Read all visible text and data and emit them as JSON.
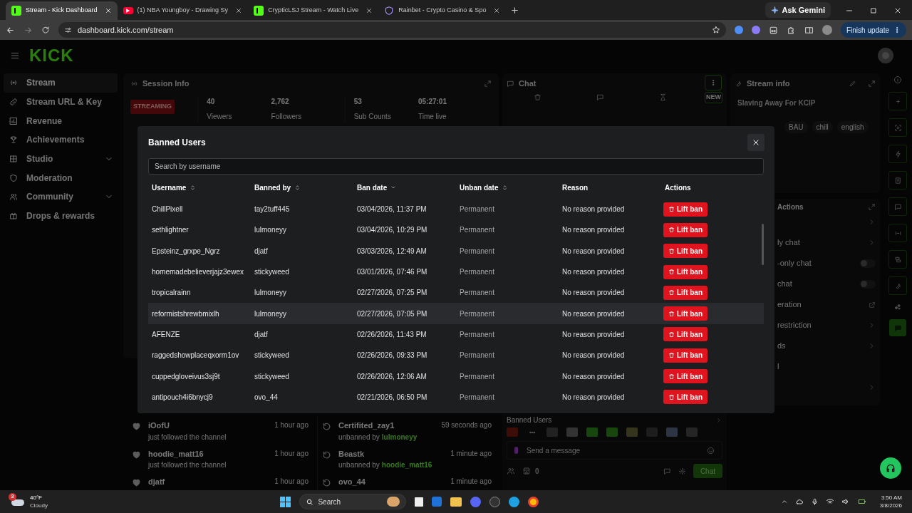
{
  "browser": {
    "tabs": [
      {
        "title": "Stream - Kick Dashboard",
        "kind": "kick",
        "selected": true
      },
      {
        "title": "(1) NBA Youngboy - Drawing Sy",
        "kind": "video",
        "selected": false
      },
      {
        "title": "CrypticLSJ Stream - Watch Live",
        "kind": "kick",
        "selected": false
      },
      {
        "title": "Rainbet - Crypto Casino & Spo",
        "kind": "casino",
        "selected": false
      }
    ],
    "ask_button": "Ask Gemini",
    "url": "dashboard.kick.com/stream",
    "update_button": "Finish update"
  },
  "header": {
    "logo": "KICK"
  },
  "sidebar": {
    "items": [
      {
        "label": "Stream",
        "chevron": false,
        "selected": true
      },
      {
        "label": "Stream URL & Key",
        "chevron": false,
        "selected": false
      },
      {
        "label": "Revenue",
        "chevron": false,
        "selected": false
      },
      {
        "label": "Achievements",
        "chevron": false,
        "selected": false
      },
      {
        "label": "Studio",
        "chevron": true,
        "selected": false
      },
      {
        "label": "Moderation",
        "chevron": false,
        "selected": false
      },
      {
        "label": "Community",
        "chevron": true,
        "selected": false
      },
      {
        "label": "Drops & rewards",
        "chevron": false,
        "selected": false
      }
    ]
  },
  "session_info": {
    "title": "Session Info",
    "status": "STREAMING",
    "stats": [
      {
        "value": "40",
        "label": "Viewers"
      },
      {
        "value": "2,762",
        "label": "Followers"
      },
      {
        "value": "53",
        "label": "Sub Counts"
      },
      {
        "value": "05:27:01",
        "label": "Time live"
      }
    ]
  },
  "chat_panel": {
    "title": "Chat",
    "new_badge": "NEW"
  },
  "stream_info": {
    "title": "Stream info",
    "stream_title": "Slaving Away For KCIP",
    "tags": [
      "BAU",
      "chill",
      "english"
    ]
  },
  "actions_panel": {
    "title": "Actions",
    "items": [
      {
        "kind": "chevron"
      },
      {
        "label": "ly chat",
        "kind": "chevron"
      },
      {
        "label": "-only chat",
        "kind": "toggle",
        "on": false
      },
      {
        "label": "chat",
        "kind": "toggle",
        "on": false
      },
      {
        "label": "eration",
        "kind": "external"
      },
      {
        "label": "restriction",
        "kind": "chevron"
      },
      {
        "label": "ds",
        "kind": "chevron"
      },
      {
        "label": "l",
        "kind": "plain"
      },
      {
        "kind": "chevron"
      }
    ]
  },
  "follower_feed": [
    {
      "name": "iOofU",
      "action": "just followed the channel",
      "time": "1 hour ago"
    },
    {
      "name": "hoodie_matt16",
      "action": "just followed the channel",
      "time": "1 hour ago"
    },
    {
      "name": "djatf",
      "time": "1 hour ago"
    }
  ],
  "unban_feed": [
    {
      "name": "Certifited_zay1",
      "action": "unbanned by",
      "by": "lulmoneyy",
      "time": "59 seconds ago"
    },
    {
      "name": "Beastk",
      "action": "unbanned by",
      "by": "hoodie_matt16",
      "time": "1 minute ago"
    },
    {
      "name": "ovo_44",
      "time": "1 minute ago"
    }
  ],
  "chat_box": {
    "section": "Banned Users",
    "placeholder": "Send a message",
    "count": "0",
    "send_button": "Chat"
  },
  "modal": {
    "title": "Banned Users",
    "search_placeholder": "Search by username",
    "columns": [
      {
        "label": "Username",
        "kind": "sortable"
      },
      {
        "label": "Banned by",
        "kind": "sortable"
      },
      {
        "label": "Ban date",
        "kind": "sorted"
      },
      {
        "label": "Unban date",
        "kind": "sortable"
      },
      {
        "label": "Reason",
        "kind": "plain"
      },
      {
        "label": "Actions",
        "kind": "plain"
      }
    ],
    "rows": [
      {
        "username": "ChillPixell",
        "banned_by": "tay2tuff445",
        "ban_date": "03/04/2026, 11:37 PM",
        "unban_date": "Permanent",
        "reason": "No reason provided",
        "action": "Lift ban",
        "highlighted": false
      },
      {
        "username": "sethlightner",
        "banned_by": "lulmoneyy",
        "ban_date": "03/04/2026, 10:29 PM",
        "unban_date": "Permanent",
        "reason": "No reason provided",
        "action": "Lift ban",
        "highlighted": false
      },
      {
        "username": "Epsteinz_grxpe_Ngrz",
        "banned_by": "djatf",
        "ban_date": "03/03/2026, 12:49 AM",
        "unban_date": "Permanent",
        "reason": "No reason provided",
        "action": "Lift ban",
        "highlighted": false
      },
      {
        "username": "homemadebelieverjajz3ewex",
        "banned_by": "stickyweed",
        "ban_date": "03/01/2026, 07:46 PM",
        "unban_date": "Permanent",
        "reason": "No reason provided",
        "action": "Lift ban",
        "highlighted": false
      },
      {
        "username": "tropicalrainn",
        "banned_by": "lulmoneyy",
        "ban_date": "02/27/2026, 07:25 PM",
        "unban_date": "Permanent",
        "reason": "No reason provided",
        "action": "Lift ban",
        "highlighted": false
      },
      {
        "username": "reformistshrewbmixlh",
        "banned_by": "lulmoneyy",
        "ban_date": "02/27/2026, 07:05 PM",
        "unban_date": "Permanent",
        "reason": "No reason provided",
        "action": "Lift ban",
        "highlighted": true
      },
      {
        "username": "AFENZE",
        "banned_by": "djatf",
        "ban_date": "02/26/2026, 11:43 PM",
        "unban_date": "Permanent",
        "reason": "No reason provided",
        "action": "Lift ban",
        "highlighted": false
      },
      {
        "username": "raggedshowplaceqxorm1ov",
        "banned_by": "stickyweed",
        "ban_date": "02/26/2026, 09:33 PM",
        "unban_date": "Permanent",
        "reason": "No reason provided",
        "action": "Lift ban",
        "highlighted": false
      },
      {
        "username": "cuppedgloveivus3sj9t",
        "banned_by": "stickyweed",
        "ban_date": "02/26/2026, 12:06 AM",
        "unban_date": "Permanent",
        "reason": "No reason provided",
        "action": "Lift ban",
        "highlighted": false
      },
      {
        "username": "antipouch4i6bnycj9",
        "banned_by": "ovo_44",
        "ban_date": "02/21/2026, 06:50 PM",
        "unban_date": "Permanent",
        "reason": "No reason provided",
        "action": "Lift ban",
        "highlighted": false
      }
    ]
  },
  "taskbar": {
    "weather_badge": "3",
    "temperature": "40°F",
    "condition": "Cloudy",
    "search": "Search",
    "time": "3:50 AM",
    "date": "3/8/2026"
  }
}
